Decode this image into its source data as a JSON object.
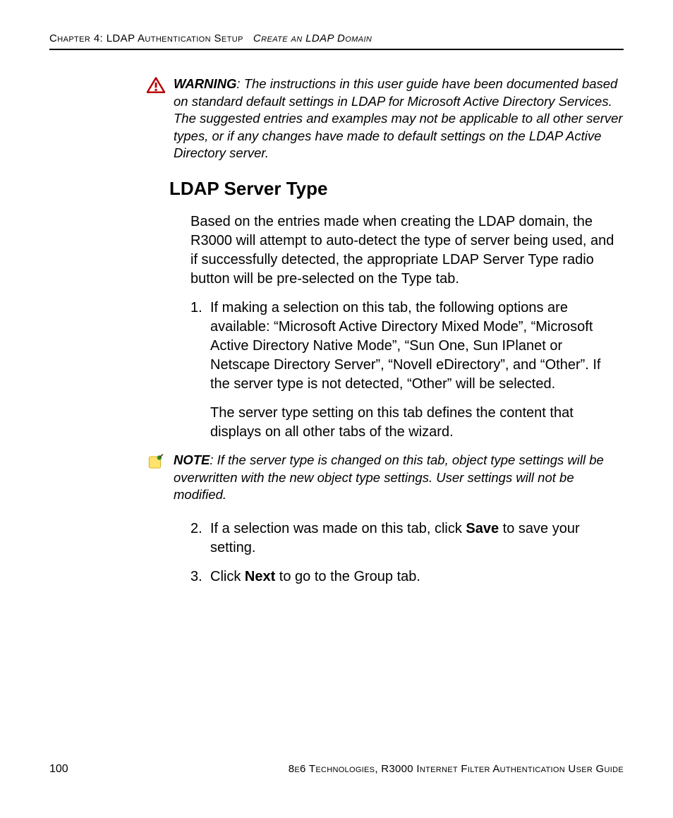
{
  "header": {
    "chapter": "Chapter 4: LDAP Authentication Setup",
    "section": "Create an LDAP Domain"
  },
  "warning": {
    "label": "WARNING",
    "text": ": The instructions in this user guide have been documented based on standard default settings in LDAP for Microsoft Active Directory Services. The suggested entries and examples may not be applicable to all other server types, or if any changes have made to default settings on the LDAP Active Directory server."
  },
  "section_title": "LDAP Server Type",
  "intro": "Based on the entries made when creating the LDAP domain, the R3000 will attempt to auto-detect the type of server being used, and if successfully detected, the appropriate LDAP Server Type radio button will be pre-selected on the Type tab.",
  "items": [
    {
      "num": "1.",
      "text": "If making a selection on this tab, the following options are available: “Microsoft Active Directory Mixed Mode”, “Microsoft Active Directory Native Mode”, “Sun One, Sun IPlanet or Netscape Directory Server”, “Novell eDirectory”, and “Other”. If the server type is not detected, “Other” will be selected.",
      "sub": "The server type setting on this tab defines the content that displays on all other tabs of the wizard."
    }
  ],
  "note": {
    "label": "NOTE",
    "text": ": If the server type is changed on this tab, object type settings will be overwritten with the new object type settings. User settings will not be modified."
  },
  "items2": [
    {
      "num": "2.",
      "pre": "If a selection was made on this tab, click ",
      "bold": "Save",
      "post": " to save your setting."
    },
    {
      "num": "3.",
      "pre": "Click ",
      "bold": "Next",
      "post": " to go to the Group tab."
    }
  ],
  "footer": {
    "page": "100",
    "text": "8e6 Technologies, R3000 Internet Filter Authentication User Guide"
  }
}
